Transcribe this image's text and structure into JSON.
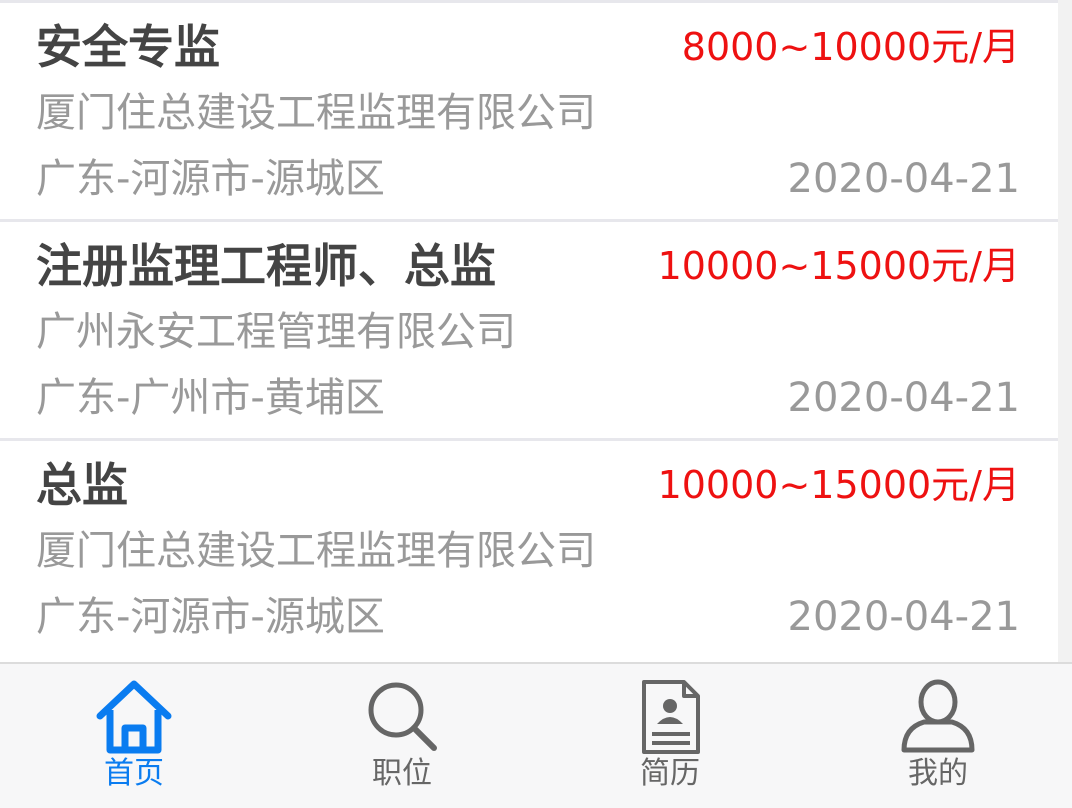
{
  "jobs": [
    {
      "title": "安全专监",
      "salary": "8000~10000元/月",
      "company": "厦门住总建设工程监理有限公司",
      "location": "广东-河源市-源城区",
      "date": "2020-04-21"
    },
    {
      "title": "注册监理工程师、总监",
      "salary": "10000~15000元/月",
      "company": "广州永安工程管理有限公司",
      "location": "广东-广州市-黄埔区",
      "date": "2020-04-21"
    },
    {
      "title": "总监",
      "salary": "10000~15000元/月",
      "company": "厦门住总建设工程监理有限公司",
      "location": "广东-河源市-源城区",
      "date": "2020-04-21"
    }
  ],
  "tabbar": {
    "items": [
      {
        "label": "首页",
        "icon": "home-icon",
        "active": true
      },
      {
        "label": "职位",
        "icon": "search-icon",
        "active": false
      },
      {
        "label": "简历",
        "icon": "resume-icon",
        "active": false
      },
      {
        "label": "我的",
        "icon": "user-icon",
        "active": false
      }
    ]
  },
  "colors": {
    "accent": "#0a7cf0",
    "salary": "#ee1111",
    "title": "#444444",
    "meta": "#999999",
    "tab_inactive": "#666666"
  }
}
